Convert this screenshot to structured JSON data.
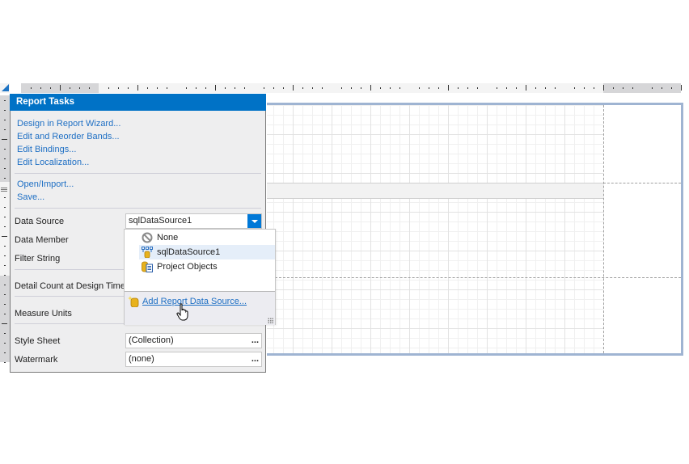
{
  "panel": {
    "title": "Report Tasks",
    "actions": [
      {
        "label": "Design in Report Wizard..."
      },
      {
        "label": "Edit and Reorder Bands..."
      },
      {
        "label": "Edit Bindings..."
      },
      {
        "label": "Edit Localization..."
      }
    ],
    "file_actions": [
      {
        "label": "Open/Import..."
      },
      {
        "label": "Save..."
      }
    ],
    "properties": {
      "data_source": {
        "label": "Data Source",
        "value": "sqlDataSource1"
      },
      "data_member": {
        "label": "Data Member"
      },
      "filter_string": {
        "label": "Filter String"
      },
      "detail_count": {
        "label": "Detail Count at Design Time"
      },
      "measure_units": {
        "label": "Measure Units"
      },
      "style_sheet": {
        "label": "Style Sheet",
        "value": "(Collection)",
        "button": "..."
      },
      "watermark": {
        "label": "Watermark",
        "value": "(none)",
        "button": "..."
      }
    }
  },
  "data_source_dropdown": {
    "items": [
      {
        "label": "None",
        "icon": "none-icon"
      },
      {
        "label": "sqlDataSource1",
        "icon": "sql-data-source-icon",
        "selected": true
      },
      {
        "label": "Project Objects",
        "icon": "project-objects-icon"
      }
    ],
    "add_link": "Add Report Data Source..."
  },
  "colors": {
    "accent": "#0072c6",
    "link": "#1e6fc4",
    "page_border": "#9fb4d2"
  }
}
